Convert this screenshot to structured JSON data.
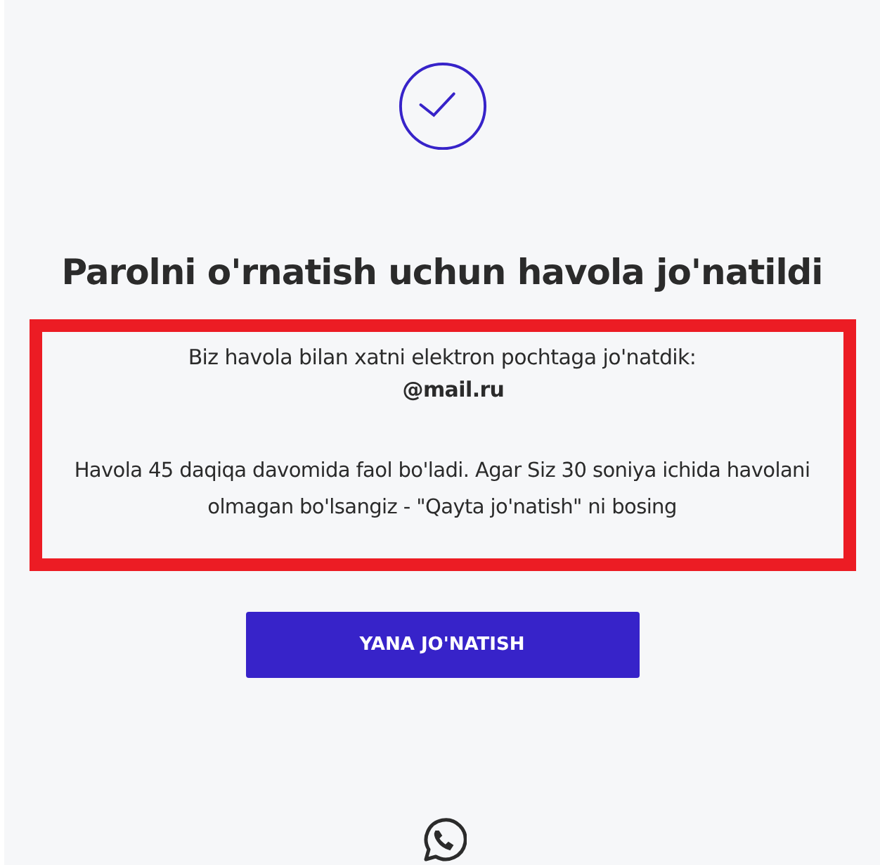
{
  "title": "Parolni o'rnatish uchun havola jo'natildi",
  "notice": {
    "sent_text": "Biz havola bilan xatni elektron pochtaga jo'natdik:",
    "email": "@mail.ru",
    "info": "Havola 45 daqiqa davomida faol bo'ladi. Agar Siz 30 soniya ichida havolani olmagan bo'lsangiz - \"Qayta jo'natish\" ni bosing"
  },
  "resend_button": "YANA JO'NATISH"
}
